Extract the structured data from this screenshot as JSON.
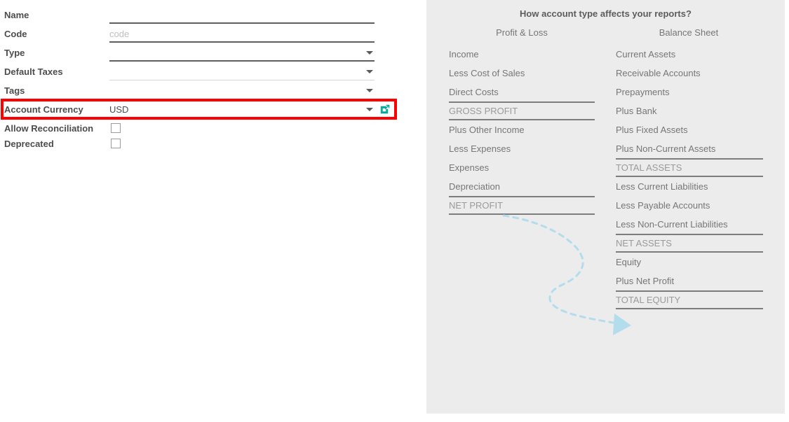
{
  "form": {
    "rows": [
      {
        "label": "Name",
        "value": "",
        "placeholder": "",
        "control": "text",
        "underline": "strong"
      },
      {
        "label": "Code",
        "value": "",
        "placeholder": "code",
        "control": "text",
        "underline": "strong"
      },
      {
        "label": "Type",
        "value": "",
        "placeholder": "",
        "control": "select",
        "underline": "strong"
      },
      {
        "label": "Default Taxes",
        "value": "",
        "placeholder": "",
        "control": "select",
        "underline": "weak"
      },
      {
        "label": "Tags",
        "value": "",
        "placeholder": "",
        "control": "select",
        "underline": "none"
      },
      {
        "label": "Account Currency",
        "value": "USD",
        "placeholder": "",
        "control": "select-link",
        "underline": "weak"
      },
      {
        "label": "Allow Reconciliation",
        "value": "",
        "placeholder": "",
        "control": "checkbox",
        "underline": "none"
      },
      {
        "label": "Deprecated",
        "value": "",
        "placeholder": "",
        "control": "checkbox",
        "underline": "none"
      }
    ],
    "checkbox_states": {
      "allow_reconciliation": false,
      "deprecated": false
    },
    "highlight_color": "#fe0000",
    "external_link_color": "#00a79d"
  },
  "report_panel": {
    "title": "How account type affects your reports?",
    "columns": [
      {
        "heading": "Profit & Loss",
        "rows": [
          {
            "label": "Income",
            "kind": "line"
          },
          {
            "label": "Less Cost of Sales",
            "kind": "line"
          },
          {
            "label": "Direct Costs",
            "kind": "line"
          },
          {
            "label": "GROSS PROFIT",
            "kind": "total"
          },
          {
            "label": "Plus Other Income",
            "kind": "line"
          },
          {
            "label": "Less Expenses",
            "kind": "line"
          },
          {
            "label": "Expenses",
            "kind": "line"
          },
          {
            "label": "Depreciation",
            "kind": "line"
          },
          {
            "label": "NET PROFIT",
            "kind": "total"
          }
        ]
      },
      {
        "heading": "Balance Sheet",
        "rows": [
          {
            "label": "Current Assets",
            "kind": "line"
          },
          {
            "label": "Receivable Accounts",
            "kind": "line"
          },
          {
            "label": "Prepayments",
            "kind": "line"
          },
          {
            "label": "Plus Bank",
            "kind": "line"
          },
          {
            "label": "Plus Fixed Assets",
            "kind": "line"
          },
          {
            "label": "Plus Non-Current Assets",
            "kind": "line"
          },
          {
            "label": "TOTAL ASSETS",
            "kind": "total"
          },
          {
            "label": "Less Current Liabilities",
            "kind": "line"
          },
          {
            "label": "Less Payable Accounts",
            "kind": "line"
          },
          {
            "label": "Less Non-Current Liabilities",
            "kind": "line"
          },
          {
            "label": "NET ASSETS",
            "kind": "total"
          },
          {
            "label": "Equity",
            "kind": "line"
          },
          {
            "label": "Plus Net Profit",
            "kind": "line"
          },
          {
            "label": "TOTAL EQUITY",
            "kind": "total"
          }
        ]
      }
    ],
    "flow_arrow": {
      "from": "NET PROFIT",
      "to": "Plus Net Profit",
      "color": "#b3dced",
      "style": "dashed-curve"
    },
    "background_color": "#ececec"
  }
}
